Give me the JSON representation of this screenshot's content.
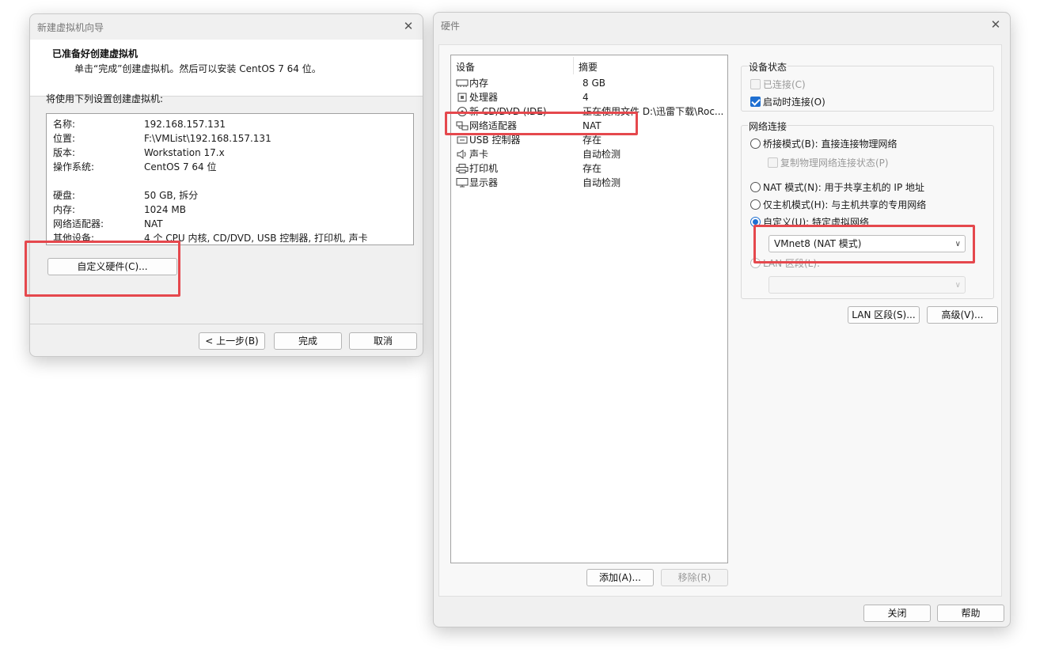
{
  "wizard": {
    "title": "新建虚拟机向导",
    "close_icon": "close-icon",
    "header_title": "已准备好创建虚拟机",
    "header_subtitle": "单击“完成”创建虚拟机。然后可以安装 CentOS 7 64 位。",
    "intro": "将使用下列设置创建虚拟机:",
    "summary": [
      {
        "key": "名称:",
        "value": "192.168.157.131"
      },
      {
        "key": "位置:",
        "value": "F:\\VMList\\192.168.157.131"
      },
      {
        "key": "版本:",
        "value": "Workstation 17.x"
      },
      {
        "key": "操作系统:",
        "value": "CentOS 7 64 位"
      },
      {
        "key": "硬盘:",
        "value": "50 GB, 拆分"
      },
      {
        "key": "内存:",
        "value": "1024 MB"
      },
      {
        "key": "网络适配器:",
        "value": "NAT"
      },
      {
        "key": "其他设备:",
        "value": "4 个 CPU 内核, CD/DVD, USB 控制器, 打印机, 声卡"
      }
    ],
    "customize_button": "自定义硬件(C)...",
    "back_button": "< 上一步(B)",
    "finish_button": "完成",
    "cancel_button": "取消",
    "highlight_color": "#e5484d"
  },
  "hardware": {
    "title": "硬件",
    "device_list": {
      "col_device": "设备",
      "col_summary": "摘要",
      "items": [
        {
          "name": "内存",
          "summary": "8 GB",
          "icon": "memory-icon"
        },
        {
          "name": "处理器",
          "summary": "4",
          "icon": "cpu-icon"
        },
        {
          "name": "新 CD/DVD (IDE)",
          "summary": "正在使用文件 D:\\迅雷下载\\Roc...",
          "icon": "cd-icon"
        },
        {
          "name": "网络适配器",
          "summary": "NAT",
          "icon": "network-adapter-icon"
        },
        {
          "name": "USB 控制器",
          "summary": "存在",
          "icon": "usb-icon"
        },
        {
          "name": "声卡",
          "summary": "自动检测",
          "icon": "sound-icon"
        },
        {
          "name": "打印机",
          "summary": "存在",
          "icon": "printer-icon"
        },
        {
          "name": "显示器",
          "summary": "自动检测",
          "icon": "monitor-icon"
        }
      ]
    },
    "add_button": "添加(A)...",
    "remove_button": "移除(R)",
    "device_status": {
      "legend": "设备状态",
      "connected": {
        "label": "已连接(C)",
        "checked": false,
        "enabled": false
      },
      "connect_on_power": {
        "label": "启动时连接(O)",
        "checked": true
      }
    },
    "network": {
      "legend": "网络连接",
      "bridged": "桥接模式(B): 直接连接物理网络",
      "replicate": "复制物理网络连接状态(P)",
      "nat": "NAT 模式(N): 用于共享主机的 IP 地址",
      "host_only": "仅主机模式(H): 与主机共享的专用网络",
      "custom": "自定义(U): 特定虚拟网络",
      "custom_value": "VMnet8 (NAT 模式)",
      "lan_segment": "LAN 区段(L):",
      "lan_segment_value": ""
    },
    "lan_segments_button": "LAN 区段(S)...",
    "advanced_button": "高级(V)...",
    "close_button": "关闭",
    "help_button": "帮助"
  }
}
